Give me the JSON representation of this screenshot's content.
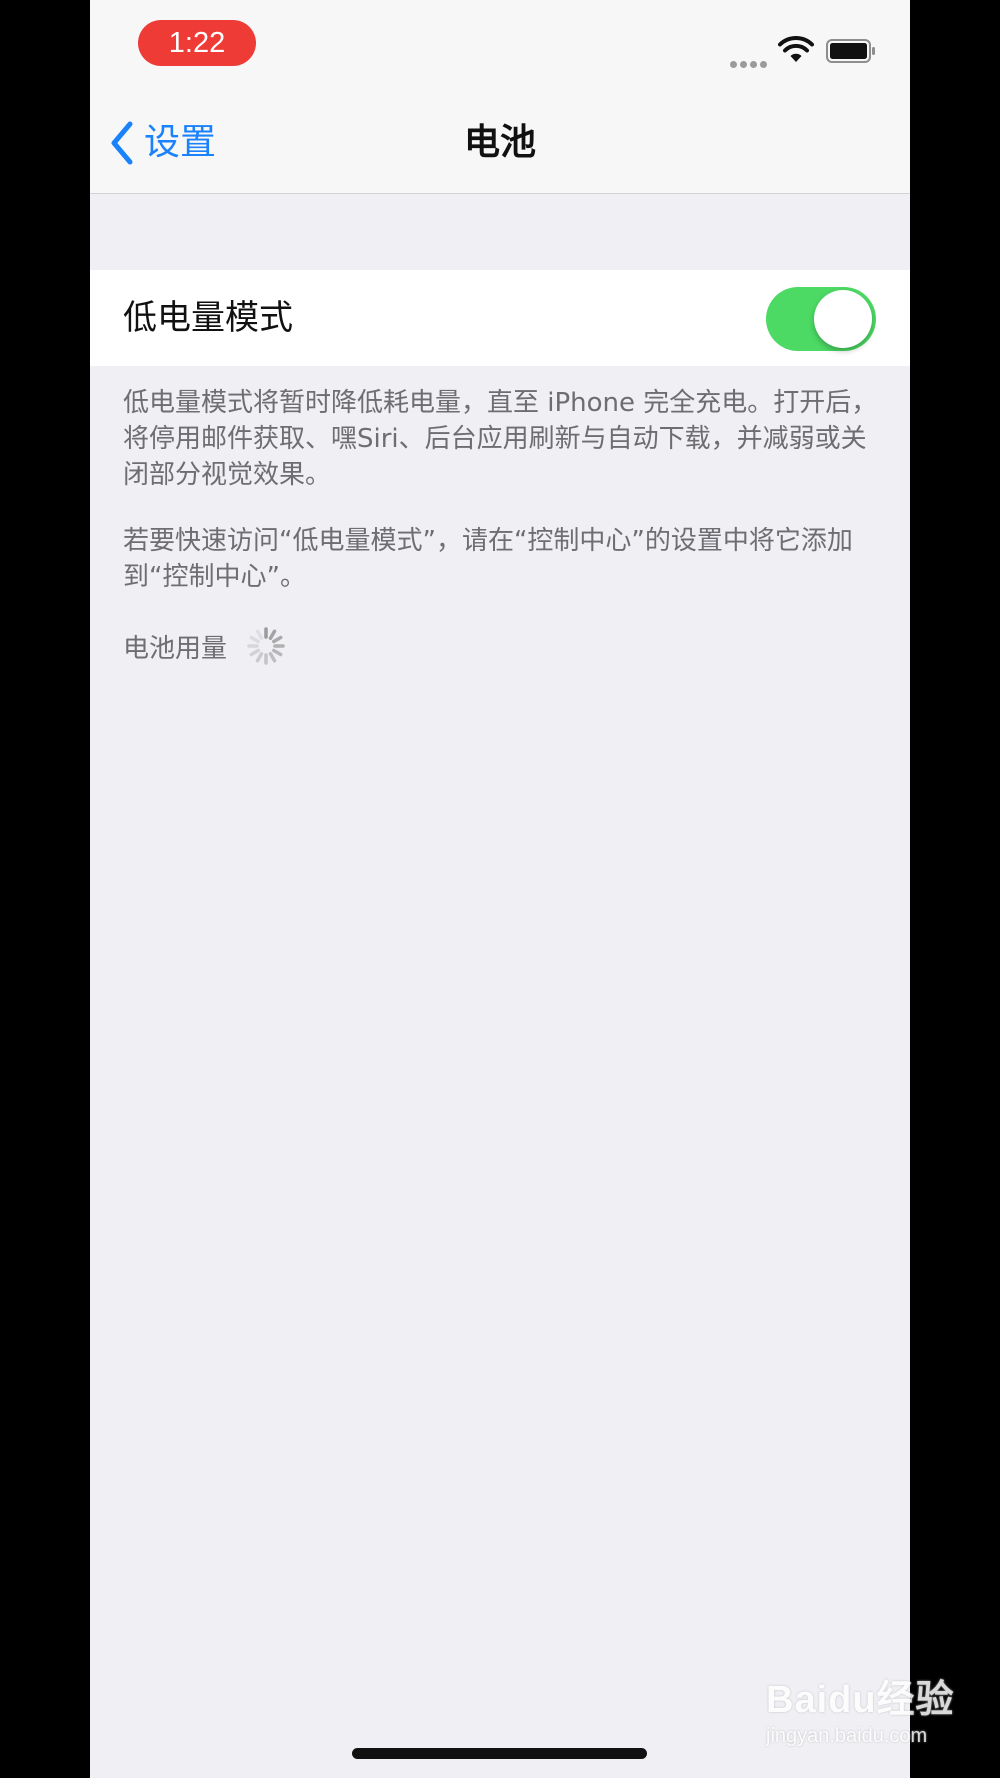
{
  "status_bar": {
    "time": "1:22",
    "time_pill_color": "#ee3b36",
    "icons": [
      "signal-dots-icon",
      "wifi-icon",
      "battery-icon"
    ]
  },
  "nav": {
    "back_label": "设置",
    "title": "电池",
    "accent_color": "#1a82fb"
  },
  "low_power": {
    "label": "低电量模式",
    "enabled": true,
    "toggle_color": "#4cd964"
  },
  "footer": {
    "description": "低电量模式将暂时降低耗电量，直至 iPhone 完全充电。打开后，将停用邮件获取、嘿Siri、后台应用刷新与自动下载，并减弱或关闭部分视觉效果。",
    "control_center_hint": "若要快速访问“低电量模式”，请在“控制中心”的设置中将它添加到“控制中心”。"
  },
  "battery_usage": {
    "label": "电池用量",
    "loading_icon": "spinner-icon"
  },
  "watermark": {
    "brand": "Baidu经验",
    "url": "jingyan.baidu.com"
  }
}
